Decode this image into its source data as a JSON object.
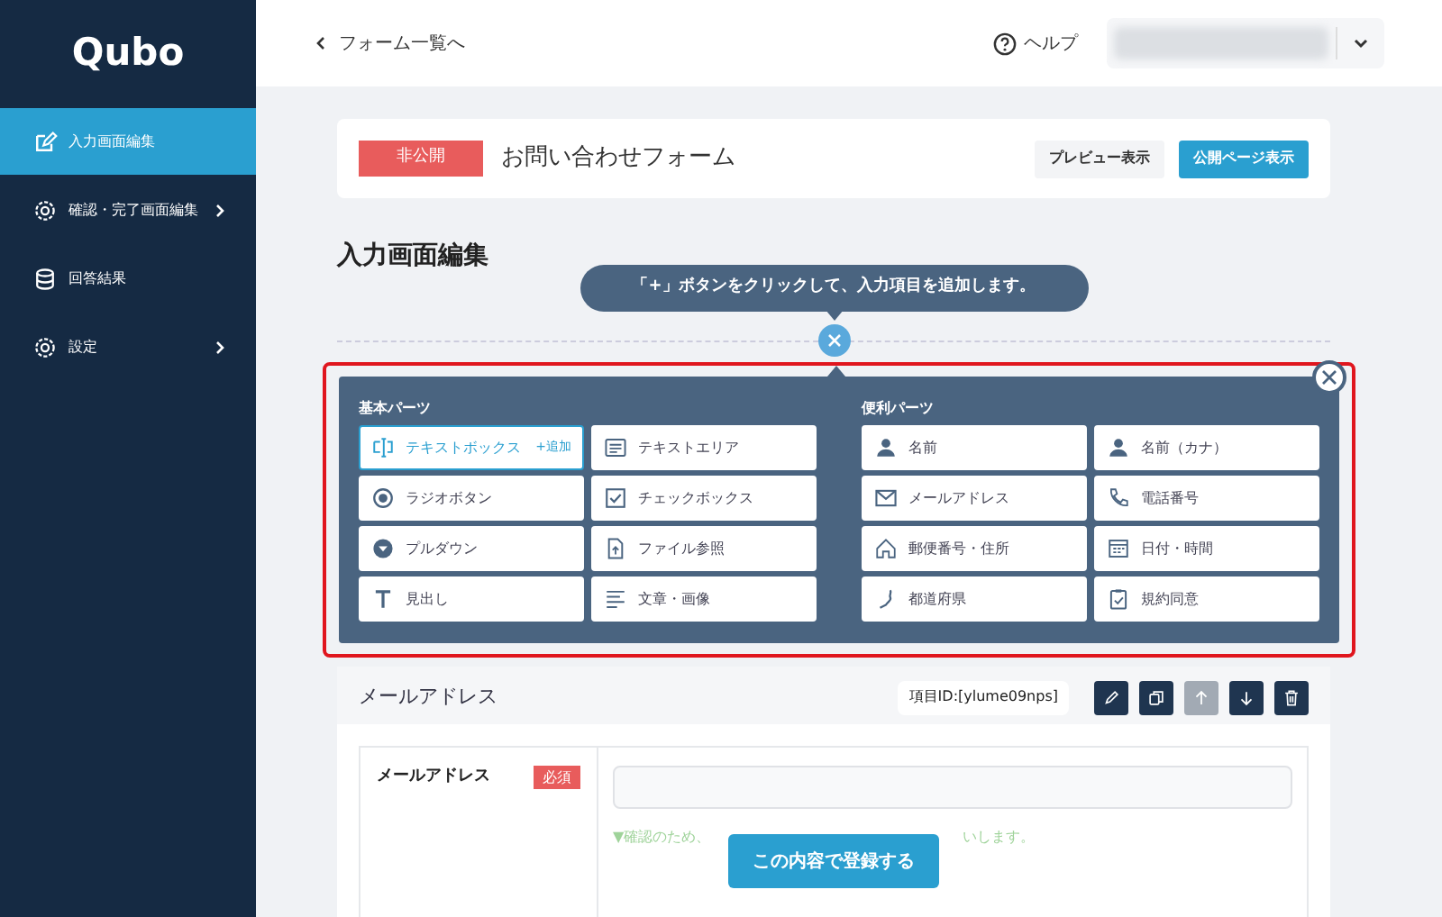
{
  "sidebar": {
    "logo": "Qubo",
    "items": [
      {
        "label": "入力画面編集",
        "kind": "edit",
        "selected": true,
        "has_submenu": false
      },
      {
        "label": "確認・完了画面編集",
        "kind": "gear",
        "selected": false,
        "has_submenu": true
      },
      {
        "label": "回答結果",
        "kind": "database",
        "selected": false,
        "has_submenu": false
      },
      {
        "label": "設定",
        "kind": "gear",
        "selected": false,
        "has_submenu": true
      }
    ]
  },
  "topbar": {
    "back_link": "フォーム一覧へ",
    "help": "ヘルプ"
  },
  "form_card": {
    "status": "非公開",
    "title": "お問い合わせフォーム",
    "buttons": [
      {
        "label": "プレビュー表示",
        "kind": "secondary"
      },
      {
        "label": "公開ページ表示",
        "kind": "primary"
      }
    ]
  },
  "heading": "入力画面編集",
  "hint_bubble": "「+」ボタンをクリックして、入力項目を追加します。",
  "parts_panel": {
    "sections": [
      {
        "title": "基本パーツ",
        "items": [
          {
            "label": "テキストボックス",
            "kind": "textbox",
            "selected": true,
            "add": "+追加"
          },
          {
            "label": "テキストエリア",
            "kind": "textarea",
            "selected": false
          },
          {
            "label": "ラジオボタン",
            "kind": "radio",
            "selected": false
          },
          {
            "label": "チェックボックス",
            "kind": "checkbox",
            "selected": false
          },
          {
            "label": "プルダウン",
            "kind": "dropdown",
            "selected": false
          },
          {
            "label": "ファイル参照",
            "kind": "file",
            "selected": false
          },
          {
            "label": "見出し",
            "kind": "heading",
            "selected": false
          },
          {
            "label": "文章・画像",
            "kind": "text",
            "selected": false
          }
        ]
      },
      {
        "title": "便利パーツ",
        "items": [
          {
            "label": "名前",
            "kind": "person",
            "selected": false
          },
          {
            "label": "名前（カナ）",
            "kind": "person",
            "selected": false
          },
          {
            "label": "メールアドレス",
            "kind": "mail",
            "selected": false
          },
          {
            "label": "電話番号",
            "kind": "phone",
            "selected": false
          },
          {
            "label": "郵便番号・住所",
            "kind": "home",
            "selected": false
          },
          {
            "label": "日付・時間",
            "kind": "calendar",
            "selected": false
          },
          {
            "label": "都道府県",
            "kind": "map",
            "selected": false
          },
          {
            "label": "規約同意",
            "kind": "clipboard",
            "selected": false
          }
        ]
      }
    ]
  },
  "field_card": {
    "title": "メールアドレス",
    "item_id": "項目ID:[ylume09nps]",
    "actions": [
      {
        "kind": "pencil",
        "disabled": false
      },
      {
        "kind": "copy",
        "disabled": false
      },
      {
        "kind": "up",
        "disabled": true
      },
      {
        "kind": "down",
        "disabled": false
      },
      {
        "kind": "trash",
        "disabled": false
      }
    ],
    "label": "メールアドレス",
    "required": "必須",
    "note_start": "▼確認のため、",
    "note_end": "いします。"
  },
  "submit_button": "この内容で登録する"
}
